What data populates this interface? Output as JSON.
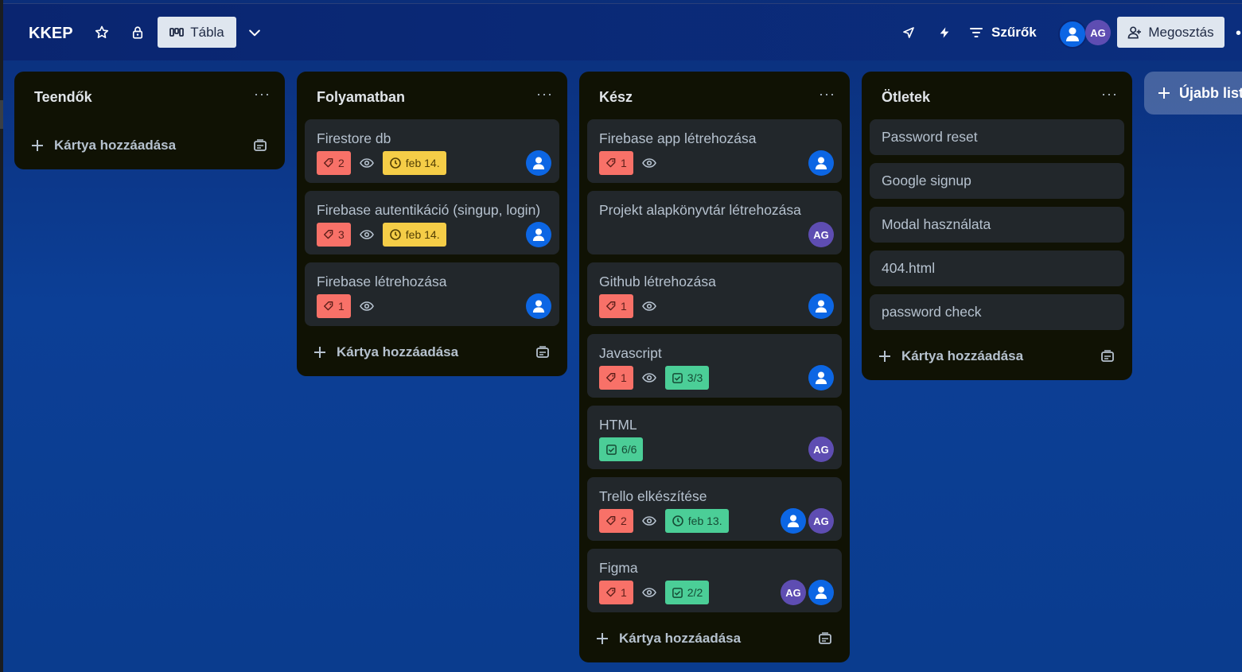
{
  "header": {
    "board_title": "KKEP",
    "view_label": "Tábla",
    "filters_label": "Szűrők",
    "member_initials": "AG",
    "share_label": "Megosztás",
    "more": "•"
  },
  "colors": {
    "label_red": "#f87168",
    "label_yellow": "#f5cd47",
    "label_green": "#4bce97",
    "avatar_blue": "#0c66e4",
    "avatar_purple": "#5e4db2"
  },
  "lists": [
    {
      "title": "Teendők",
      "menu": "···",
      "add_card_label": "Kártya hozzáadása",
      "cards": []
    },
    {
      "title": "Folyamatban",
      "menu": "···",
      "add_card_label": "Kártya hozzáadása",
      "cards": [
        {
          "title": "Firestore db",
          "labels_count": "2",
          "date": "feb 14.",
          "avatars": [
            "blue"
          ]
        },
        {
          "title": "Firebase autentikáció (singup, login)",
          "labels_count": "3",
          "date": "feb 14.",
          "avatars": [
            "blue"
          ]
        },
        {
          "title": "Firebase létrehozása",
          "labels_count": "1",
          "avatars": [
            "blue"
          ]
        }
      ]
    },
    {
      "title": "Kész",
      "menu": "···",
      "add_card_label": "Kártya hozzáadása",
      "cards": [
        {
          "title": "Firebase app létrehozása",
          "labels_count": "1",
          "avatars": [
            "blue"
          ]
        },
        {
          "title": "Projekt alapkönyvtár létrehozása",
          "avatars": [
            "AG"
          ]
        },
        {
          "title": "Github létrehozása",
          "labels_count": "1",
          "avatars": [
            "blue"
          ]
        },
        {
          "title": "Javascript",
          "labels_count": "1",
          "checklist": "3/3",
          "avatars": [
            "blue"
          ]
        },
        {
          "title": "HTML",
          "checklist": "6/6",
          "avatars": [
            "AG"
          ]
        },
        {
          "title": "Trello elkészítése",
          "labels_count": "2",
          "date": "feb 13.",
          "date_done": true,
          "avatars": [
            "blue",
            "AG"
          ]
        },
        {
          "title": "Figma",
          "labels_count": "1",
          "checklist": "2/2",
          "avatars": [
            "AG",
            "blue"
          ]
        }
      ]
    },
    {
      "title": "Ötletek",
      "menu": "···",
      "add_card_label": "Kártya hozzáadása",
      "cards": [
        {
          "title": "Password reset"
        },
        {
          "title": "Google signup"
        },
        {
          "title": "Modal használata"
        },
        {
          "title": "404.html"
        },
        {
          "title": "password check"
        }
      ]
    }
  ],
  "add_list_label": "Újabb lista"
}
